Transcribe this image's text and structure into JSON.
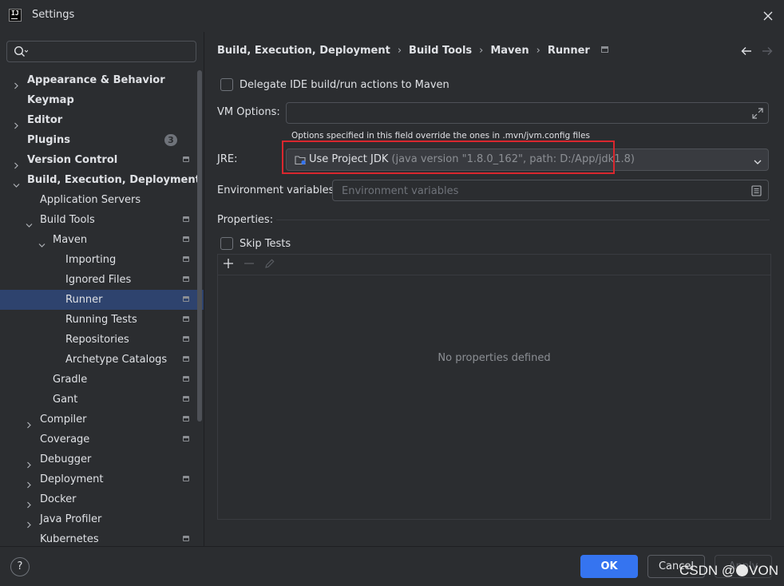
{
  "window": {
    "title": "Settings",
    "app_icon_text": "IJ"
  },
  "search": {
    "placeholder": "",
    "value": ""
  },
  "tree": [
    {
      "label": "Appearance & Behavior",
      "bold": true,
      "indent": 0,
      "chevron": "right",
      "project": false
    },
    {
      "label": "Keymap",
      "bold": true,
      "indent": 0,
      "chevron": "",
      "project": false
    },
    {
      "label": "Editor",
      "bold": true,
      "indent": 0,
      "chevron": "right",
      "project": false
    },
    {
      "label": "Plugins",
      "bold": true,
      "indent": 0,
      "chevron": "",
      "project": false,
      "badge": "3"
    },
    {
      "label": "Version Control",
      "bold": true,
      "indent": 0,
      "chevron": "right",
      "project": true
    },
    {
      "label": "Build, Execution, Deployment",
      "bold": true,
      "indent": 0,
      "chevron": "down",
      "project": false
    },
    {
      "label": "Application Servers",
      "bold": false,
      "indent": 1,
      "chevron": "",
      "project": false
    },
    {
      "label": "Build Tools",
      "bold": false,
      "indent": 1,
      "chevron": "down",
      "project": true
    },
    {
      "label": "Maven",
      "bold": false,
      "indent": 2,
      "chevron": "down",
      "project": true
    },
    {
      "label": "Importing",
      "bold": false,
      "indent": 3,
      "chevron": "",
      "project": true
    },
    {
      "label": "Ignored Files",
      "bold": false,
      "indent": 3,
      "chevron": "",
      "project": true
    },
    {
      "label": "Runner",
      "bold": false,
      "indent": 3,
      "chevron": "",
      "project": true,
      "selected": true
    },
    {
      "label": "Running Tests",
      "bold": false,
      "indent": 3,
      "chevron": "",
      "project": true
    },
    {
      "label": "Repositories",
      "bold": false,
      "indent": 3,
      "chevron": "",
      "project": true
    },
    {
      "label": "Archetype Catalogs",
      "bold": false,
      "indent": 3,
      "chevron": "",
      "project": true
    },
    {
      "label": "Gradle",
      "bold": false,
      "indent": 2,
      "chevron": "",
      "project": true
    },
    {
      "label": "Gant",
      "bold": false,
      "indent": 2,
      "chevron": "",
      "project": true
    },
    {
      "label": "Compiler",
      "bold": false,
      "indent": 1,
      "chevron": "right",
      "project": true
    },
    {
      "label": "Coverage",
      "bold": false,
      "indent": 1,
      "chevron": "",
      "project": true
    },
    {
      "label": "Debugger",
      "bold": false,
      "indent": 1,
      "chevron": "right",
      "project": false
    },
    {
      "label": "Deployment",
      "bold": false,
      "indent": 1,
      "chevron": "right",
      "project": true
    },
    {
      "label": "Docker",
      "bold": false,
      "indent": 1,
      "chevron": "right",
      "project": false
    },
    {
      "label": "Java Profiler",
      "bold": false,
      "indent": 1,
      "chevron": "right",
      "project": false
    },
    {
      "label": "Kubernetes",
      "bold": false,
      "indent": 1,
      "chevron": "",
      "project": true
    }
  ],
  "breadcrumb": [
    "Build, Execution, Deployment",
    "Build Tools",
    "Maven",
    "Runner"
  ],
  "form": {
    "delegate_label": "Delegate IDE build/run actions to Maven",
    "delegate_checked": false,
    "vm_options_label": "VM Options:",
    "vm_options_value": "",
    "vm_options_hint": "Options specified in this field override the ones in .mvn/jvm.config files",
    "jre_label": "JRE:",
    "jre_value": "Use Project JDK",
    "jre_detail": "(java version \"1.8.0_162\", path: D:/App/jdk1.8)",
    "env_label": "Environment variables:",
    "env_placeholder": "Environment variables",
    "properties_label": "Properties:",
    "skip_tests_label": "Skip Tests",
    "skip_tests_checked": false,
    "properties_empty": "No properties defined"
  },
  "buttons": {
    "ok": "OK",
    "cancel": "Cancel",
    "apply": "Apply",
    "help": "?"
  },
  "watermark": {
    "prefix": "CSDN @",
    "suffix": "VON"
  },
  "colors": {
    "accent": "#3574f0",
    "selection": "#2e436e",
    "highlight_box": "#d9272e",
    "background": "#2b2d30"
  }
}
